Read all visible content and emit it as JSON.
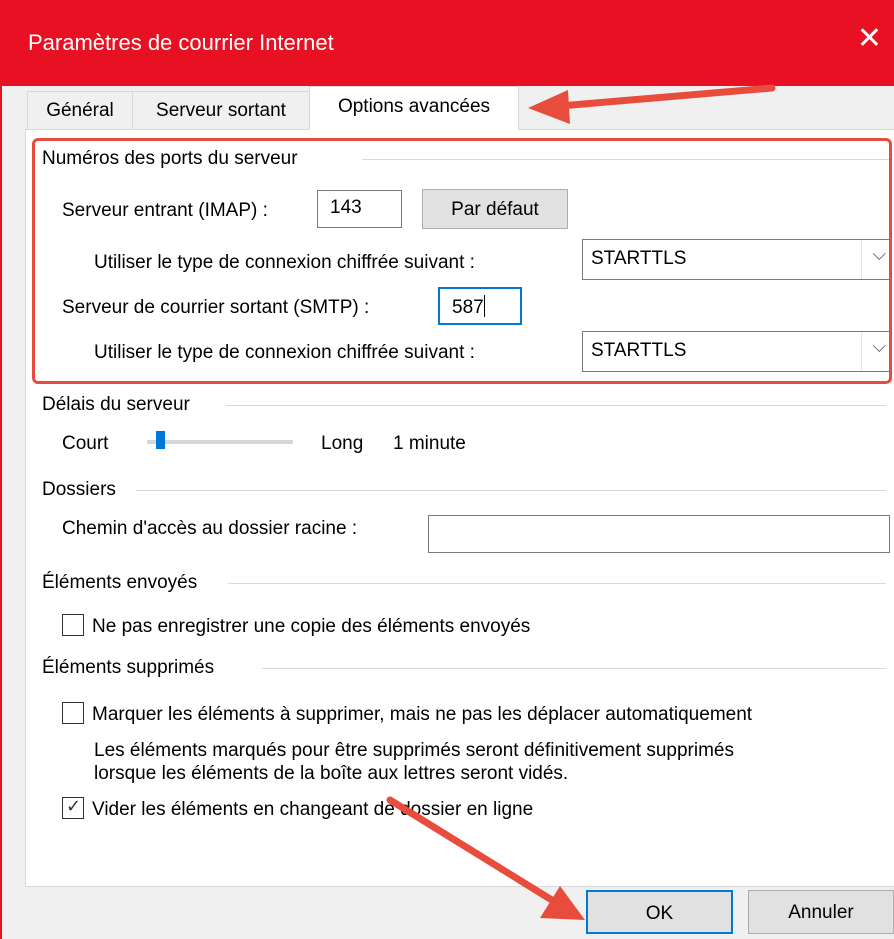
{
  "window": {
    "title": "Paramètres de courrier Internet",
    "close_icon": "close-icon",
    "accent": "#e81123"
  },
  "tabs": [
    {
      "label": "Général",
      "active": false
    },
    {
      "label": "Serveur sortant",
      "active": false
    },
    {
      "label": "Options avancées",
      "active": true
    }
  ],
  "ports": {
    "group_title": "Numéros des ports du serveur",
    "incoming_label": "Serveur entrant (IMAP) :",
    "incoming_value": "143",
    "default_button": "Par défaut",
    "encryption_label_1": "Utiliser le type de connexion chiffrée suivant :",
    "encryption_value_1": "STARTTLS",
    "outgoing_label": "Serveur de courrier sortant (SMTP) :",
    "outgoing_value": "587",
    "encryption_label_2": "Utiliser le type de connexion chiffrée suivant :",
    "encryption_value_2": "STARTTLS"
  },
  "timeout": {
    "group_title": "Délais du serveur",
    "short_label": "Court",
    "long_label": "Long",
    "value_label": "1 minute",
    "slider_level": 0.06
  },
  "folders": {
    "group_title": "Dossiers",
    "root_label": "Chemin d'accès au dossier racine :",
    "root_value": ""
  },
  "sent": {
    "group_title": "Éléments envoyés",
    "no_copy_label": "Ne pas enregistrer une copie des éléments envoyés",
    "no_copy_checked": false
  },
  "deleted": {
    "group_title": "Éléments supprimés",
    "mark_label": "Marquer les éléments à supprimer, mais ne pas les déplacer automatiquement",
    "mark_checked": false,
    "mark_note_1": "Les éléments marqués pour être supprimés seront définitivement supprimés",
    "mark_note_2": "lorsque les éléments de la boîte aux lettres seront vidés.",
    "purge_label": "Vider les éléments en changeant de dossier en ligne",
    "purge_checked": true
  },
  "footer": {
    "ok": "OK",
    "cancel": "Annuler"
  },
  "annotations": {
    "highlight_color": "#e74c3c"
  }
}
